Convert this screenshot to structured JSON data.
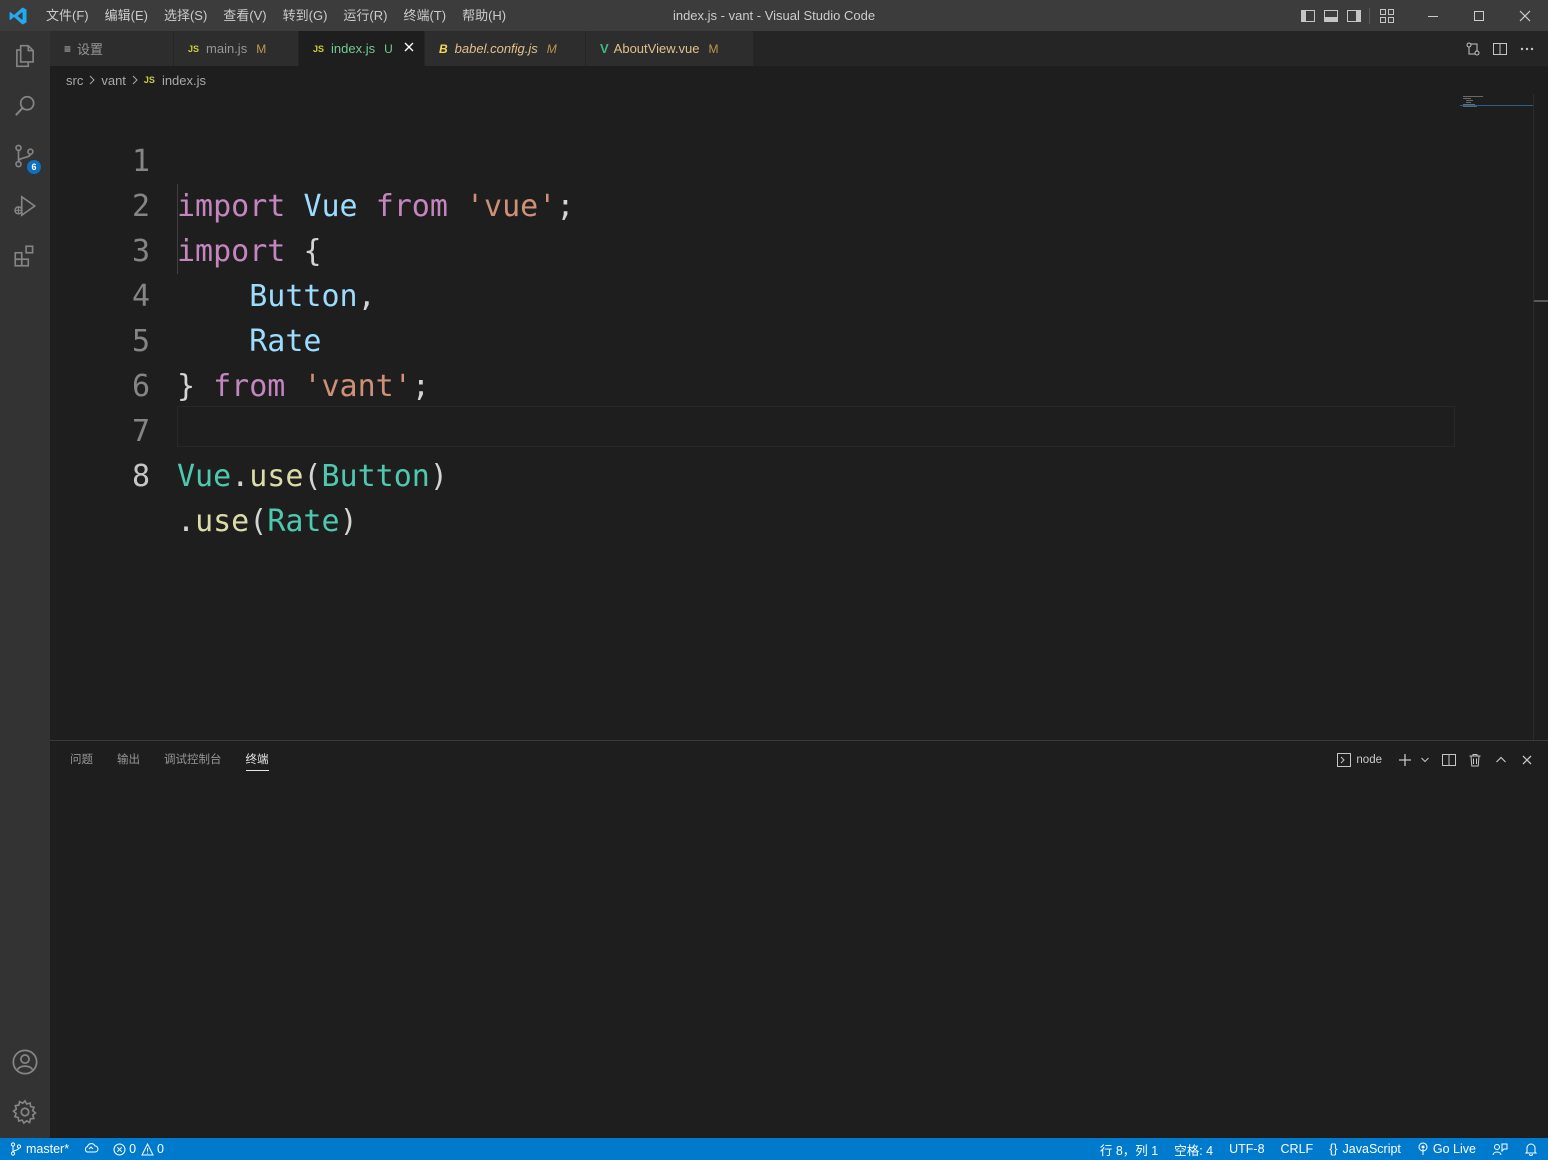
{
  "titlebar": {
    "menu": [
      "文件(F)",
      "编辑(E)",
      "选择(S)",
      "查看(V)",
      "转到(G)",
      "运行(R)",
      "终端(T)",
      "帮助(H)"
    ],
    "window_title": "index.js - vant - Visual Studio Code"
  },
  "activity_bar": {
    "source_control_badge": "6"
  },
  "tabs": [
    {
      "icon": "≡",
      "label": "设置",
      "status": "",
      "active": false
    },
    {
      "icon": "JS",
      "label": "main.js",
      "status": "M",
      "active": false
    },
    {
      "icon": "JS",
      "label": "index.js",
      "status": "U",
      "active": true
    },
    {
      "icon": "B",
      "label": "babel.config.js",
      "status": "M",
      "active": false
    },
    {
      "icon": "V",
      "label": "AboutView.vue",
      "status": "M",
      "active": false
    }
  ],
  "breadcrumb": {
    "parts": [
      "src",
      "vant"
    ],
    "file_icon": "JS",
    "file": "index.js"
  },
  "editor": {
    "line_numbers": [
      "1",
      "2",
      "3",
      "4",
      "5",
      "6",
      "7",
      "8"
    ],
    "current_line": 8,
    "tokens": {
      "l1": [
        "import",
        " ",
        "Vue",
        " ",
        "from",
        " ",
        "'vue'",
        ";"
      ],
      "l2": [
        "import",
        " ",
        "{"
      ],
      "l3": [
        "    ",
        "Button",
        ","
      ],
      "l4": [
        "    ",
        "Rate"
      ],
      "l5": [
        "}",
        " ",
        "from",
        " ",
        "'vant'",
        ";"
      ],
      "l7": [
        "Vue",
        ".",
        "use",
        "(",
        "Button",
        ")"
      ],
      "l8": [
        ".",
        "use",
        "(",
        "Rate",
        ")"
      ]
    }
  },
  "panel": {
    "tabs": [
      "问题",
      "输出",
      "调试控制台",
      "终端"
    ],
    "active_tab": "终端",
    "terminal_name": "node"
  },
  "statusbar": {
    "branch": "master*",
    "errors": "0",
    "warnings": "0",
    "cursor": "行 8，列 1",
    "indent": "空格: 4",
    "encoding": "UTF-8",
    "eol": "CRLF",
    "language": "JavaScript",
    "golive": "Go Live"
  },
  "colors": {
    "accent": "#007acc",
    "keyword": "#c586c0",
    "variable": "#9cdcfe",
    "string": "#ce9178",
    "class": "#4ec9b0",
    "function": "#dcdcaa"
  }
}
